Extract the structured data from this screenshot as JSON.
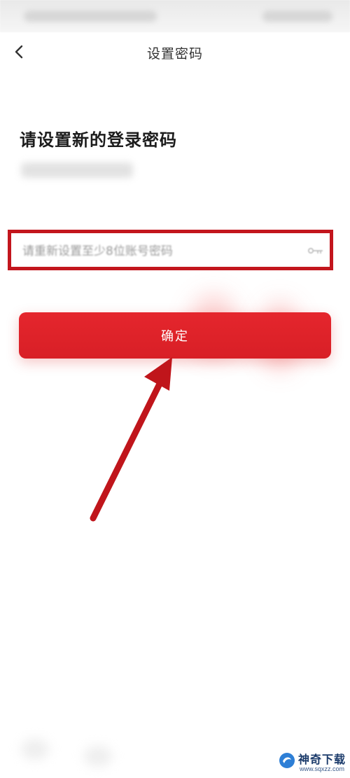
{
  "nav": {
    "title": "设置密码",
    "back_icon": "chevron-left-icon"
  },
  "form": {
    "heading": "请设置新的登录密码",
    "password_placeholder": "请重新设置至少8位账号密码",
    "key_icon": "key-icon"
  },
  "actions": {
    "confirm_label": "确定"
  },
  "watermark": {
    "brand": "神奇下载",
    "url": "www.sqxzz.com"
  },
  "colors": {
    "accent_red": "#e5262d",
    "highlight_border": "#c3161d",
    "arrow": "#c0151b"
  }
}
